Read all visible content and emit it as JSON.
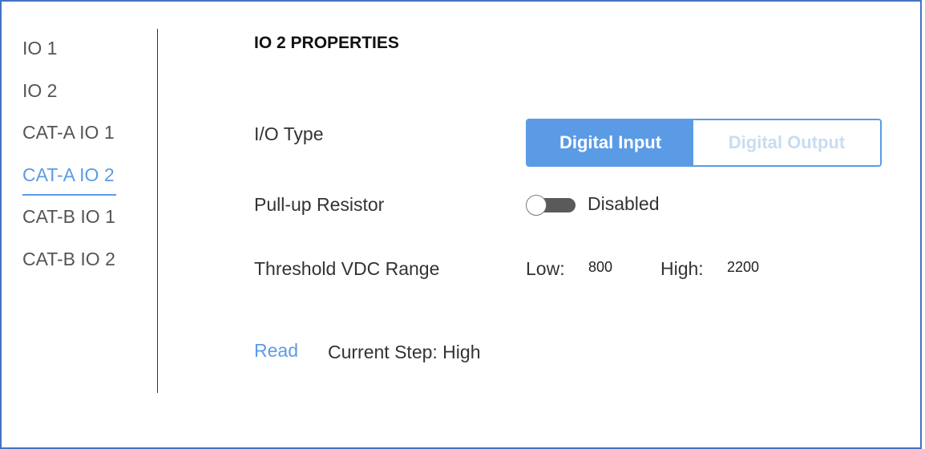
{
  "sidebar": {
    "items": [
      {
        "label": "IO 1",
        "active": false
      },
      {
        "label": "IO 2",
        "active": false
      },
      {
        "label": "CAT-A IO 1",
        "active": false
      },
      {
        "label": "CAT-A IO 2",
        "active": true
      },
      {
        "label": "CAT-B IO 1",
        "active": false
      },
      {
        "label": "CAT-B IO 2",
        "active": false
      }
    ]
  },
  "main": {
    "title": "IO 2 PROPERTIES",
    "io_type": {
      "label": "I/O Type",
      "options": [
        "Digital Input",
        "Digital Output"
      ],
      "selected": "Digital Input"
    },
    "pullup": {
      "label": "Pull-up Resistor",
      "state_text": "Disabled",
      "enabled": false
    },
    "threshold": {
      "label": "Threshold VDC Range",
      "low_label": "Low:",
      "low_value": "800",
      "high_label": "High:",
      "high_value": "2200"
    },
    "read": {
      "link_label": "Read",
      "status_text": "Current Step: High"
    }
  },
  "colors": {
    "accent": "#5b9be6",
    "frame_border": "#4472c4",
    "toggle_off": "#5a5a5a"
  }
}
